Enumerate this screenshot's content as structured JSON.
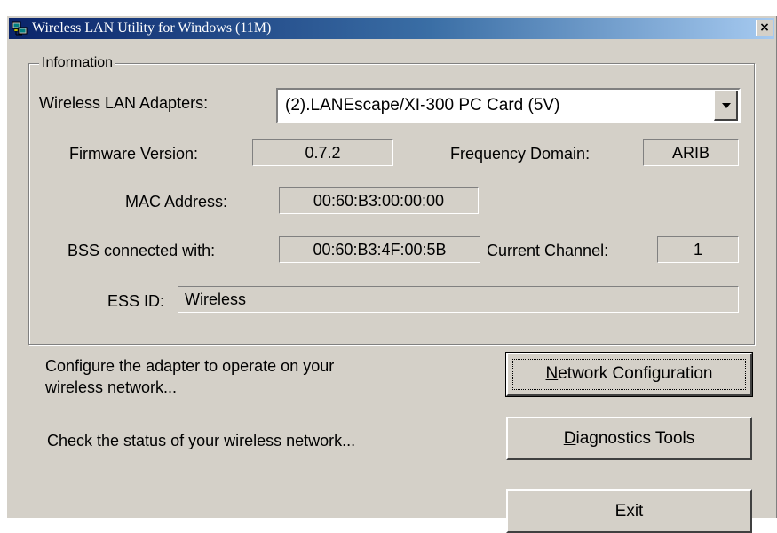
{
  "window": {
    "title": "Wireless LAN Utility for Windows (11M)",
    "close_glyph": "×",
    "icon": "network-computers-icon"
  },
  "info_group": {
    "legend": "Information",
    "adapters_label": "Wireless LAN Adapters:",
    "adapter_selected": "(2).LANEscape/XI-300 PC Card (5V)",
    "firmware_label": "Firmware Version:",
    "firmware_value": "0.7.2",
    "frequency_label": "Frequency Domain:",
    "frequency_value": "ARIB",
    "mac_label": "MAC Address:",
    "mac_value": "00:60:B3:00:00:00",
    "bss_label": "BSS connected with:",
    "bss_value": "00:60:B3:4F:00:5B",
    "channel_label": "Current Channel:",
    "channel_value": "1",
    "essid_label": "ESS ID:",
    "essid_value": "Wireless"
  },
  "actions": {
    "configure_text_line1": "Configure the adapter to operate on your",
    "configure_text_line2": "wireless network...",
    "network_config_mnemonic": "N",
    "network_config_rest": "etwork Configuration",
    "status_text": "Check the status of your wireless network...",
    "diagnostics_mnemonic": "D",
    "diagnostics_rest": "iagnostics Tools",
    "exit_label": "Exit"
  },
  "colors": {
    "title_active": "#0a246a",
    "face": "#d4d0c8"
  }
}
